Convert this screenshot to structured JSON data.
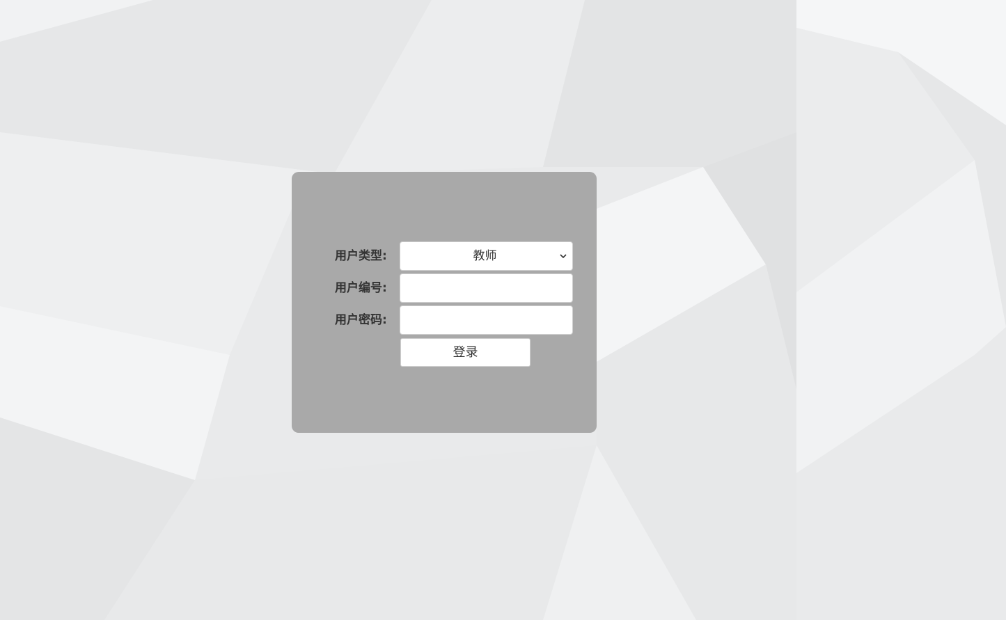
{
  "login": {
    "user_type_label": "用户类型:",
    "user_type_selected": "教师",
    "user_id_label": "用户编号:",
    "user_id_value": "",
    "password_label": "用户密码:",
    "password_value": "",
    "submit_label": "登录"
  },
  "icons": {
    "select_arrow": "chevron-down-icon"
  },
  "colors": {
    "background": "#e9eaeb",
    "panel": "#a9a9a9",
    "label_text": "#333333",
    "field_bg": "#ffffff"
  }
}
